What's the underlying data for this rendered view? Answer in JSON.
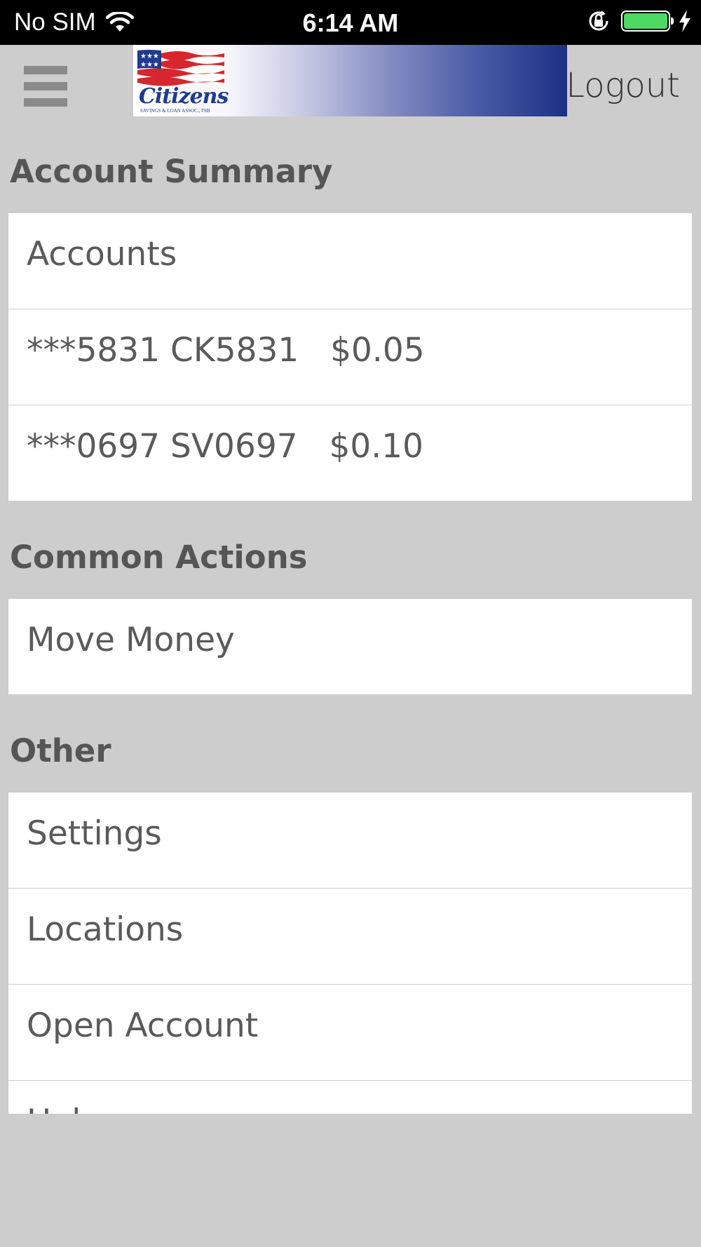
{
  "status_bar": {
    "carrier": "No SIM",
    "time": "6:14 AM",
    "battery_color": "#4cd964"
  },
  "header": {
    "menu_icon": "hamburger-icon",
    "logo_text": "Citizens",
    "logo_subtext": "SAVINGS & LOAN ASSOC., FSB",
    "logout_label": "Logout"
  },
  "sections": {
    "account_summary": {
      "title": "Account Summary",
      "items": [
        "Accounts",
        "***5831 CK5831   $0.05",
        "***0697 SV0697   $0.10"
      ]
    },
    "common_actions": {
      "title": "Common Actions",
      "items": [
        "Move Money"
      ]
    },
    "other": {
      "title": "Other",
      "items": [
        "Settings",
        "Locations",
        "Open Account",
        "Help"
      ]
    }
  }
}
